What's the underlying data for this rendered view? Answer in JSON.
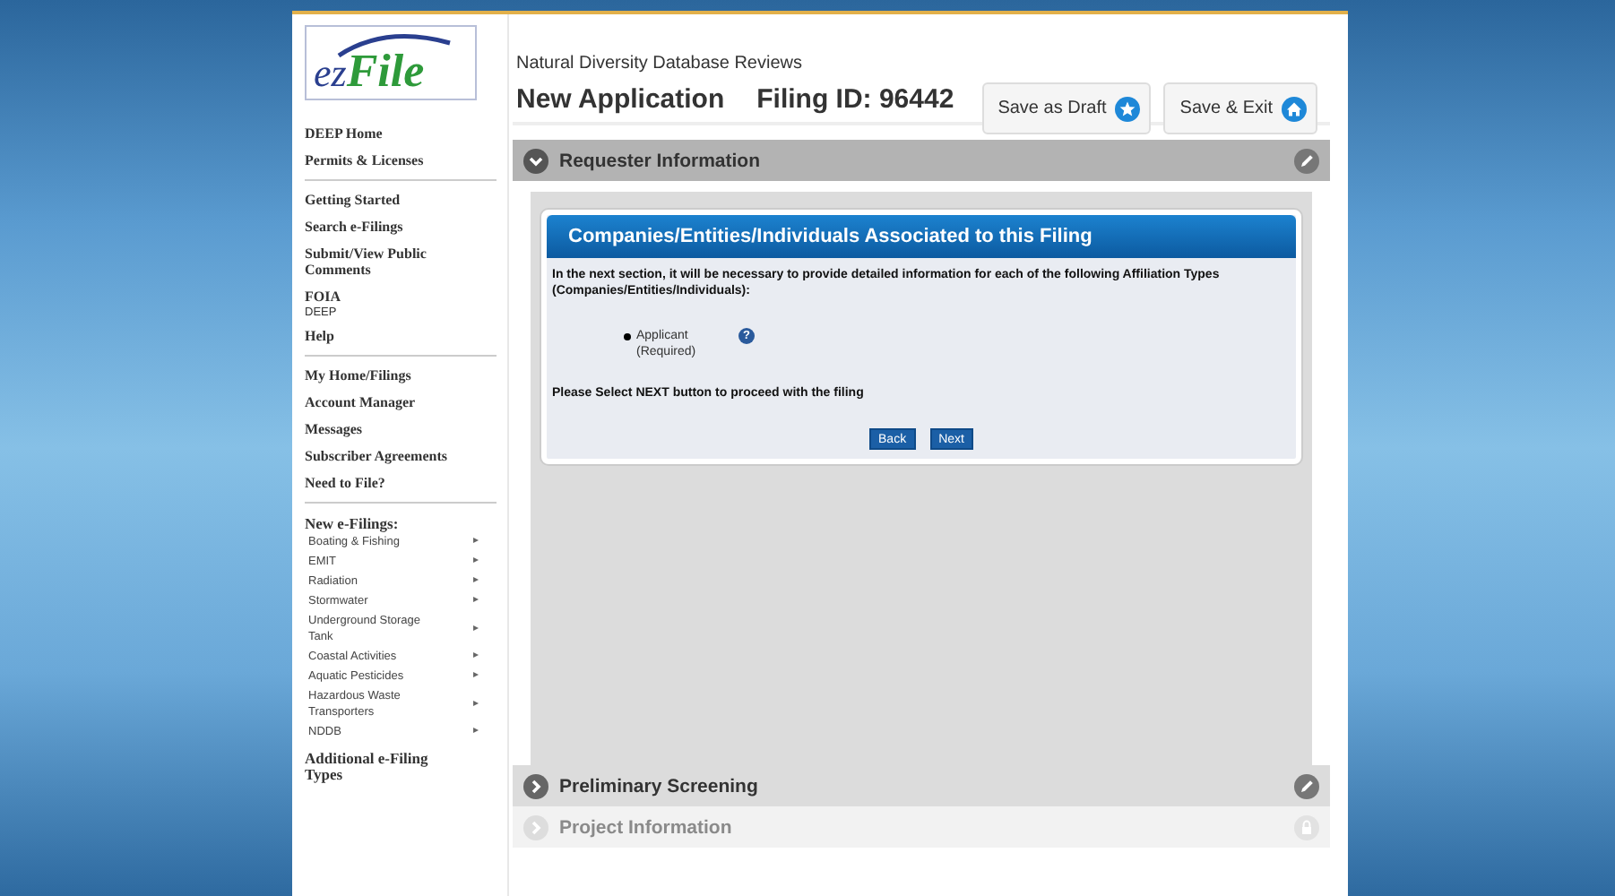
{
  "sidebar": {
    "logo": {
      "prefix": "ez",
      "name": "File"
    },
    "groups": [
      [
        {
          "kind": "link",
          "label": "DEEP Home"
        },
        {
          "kind": "link",
          "label": "Permits & Licenses"
        }
      ],
      [
        {
          "kind": "link",
          "label": "Getting Started"
        },
        {
          "kind": "link",
          "label": "Search e-Filings"
        },
        {
          "kind": "link",
          "label": "Submit/View Public Comments"
        },
        {
          "kind": "link",
          "label": "FOIA",
          "note": "DEEP"
        },
        {
          "kind": "link",
          "label": "Help"
        }
      ],
      [
        {
          "kind": "link",
          "label": "My Home/Filings"
        },
        {
          "kind": "link",
          "label": "Account Manager"
        },
        {
          "kind": "link",
          "label": "Messages"
        },
        {
          "kind": "link",
          "label": "Subscriber Agreements"
        },
        {
          "kind": "link",
          "label": "Need to File?"
        }
      ],
      [
        {
          "kind": "heading",
          "label": "New e-Filings:"
        },
        {
          "kind": "submenu",
          "label": "Boating & Fishing",
          "arrow": "▸"
        },
        {
          "kind": "submenu",
          "label": "EMIT",
          "arrow": "▸"
        },
        {
          "kind": "submenu",
          "label": "Radiation",
          "arrow": "▸"
        },
        {
          "kind": "submenu",
          "label": "Stormwater",
          "arrow": "▸"
        },
        {
          "kind": "submenu",
          "label": "Underground Storage Tank",
          "arrow": "▸"
        },
        {
          "kind": "submenu",
          "label": "Coastal Activities",
          "arrow": "▸"
        },
        {
          "kind": "submenu",
          "label": "Aquatic Pesticides",
          "arrow": "▸"
        },
        {
          "kind": "submenu",
          "label": "Hazardous Waste Transporters",
          "arrow": "▸"
        },
        {
          "kind": "submenu",
          "label": "NDDB",
          "arrow": "▸"
        },
        {
          "kind": "group_link",
          "label": "Additional e-Filing Types"
        }
      ]
    ]
  },
  "header": {
    "subtitle": "Natural Diversity Database Reviews",
    "title": "New Application",
    "filing_id": "Filing ID: 96442",
    "buttons": [
      {
        "label": "Save as Draft"
      },
      {
        "label": "Save & Exit"
      }
    ]
  },
  "sections": [
    {
      "title": "Requester Information",
      "expanded": true,
      "disabled": false
    },
    {
      "title": "Preliminary Screening",
      "expanded": false,
      "disabled": false
    },
    {
      "title": "Project Information",
      "expanded": false,
      "disabled": true
    }
  ],
  "panel": {
    "title": "Companies/Entities/Individuals Associated to this Filing",
    "intro": "In the next section, it will be necessary to provide detailed information for each of the following Affiliation Types (Companies/Entities/Individuals):",
    "affiliations": [
      {
        "label": "Applicant",
        "note": "(Required)",
        "help": "?"
      }
    ],
    "instruction": "Please Select NEXT button to proceed with the filing",
    "buttons": [
      "Back",
      "Next"
    ]
  }
}
